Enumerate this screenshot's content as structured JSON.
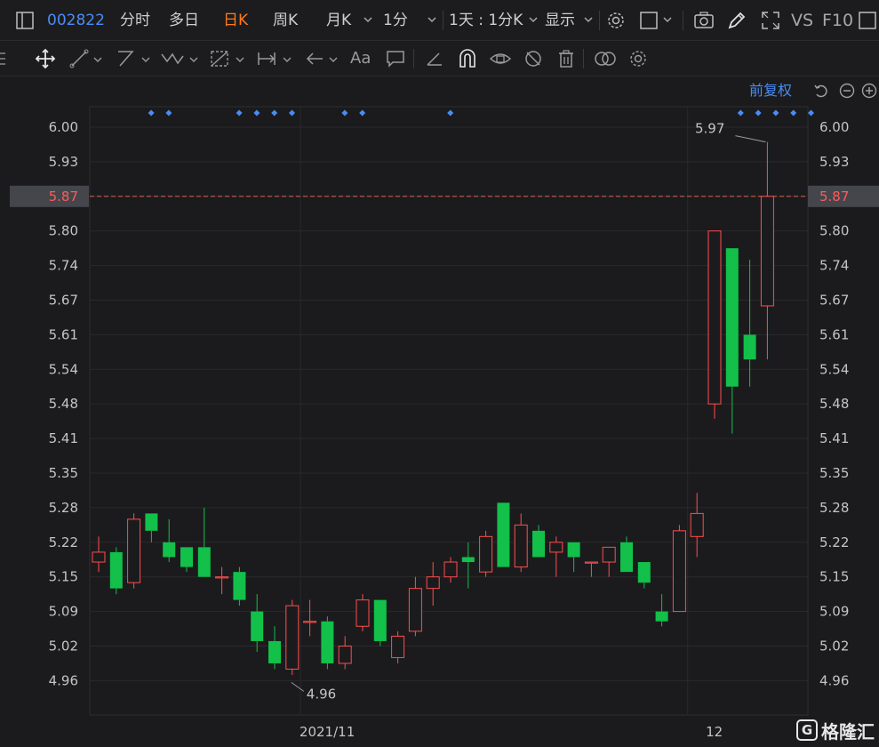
{
  "header": {
    "stock_code": "002822",
    "tabs": [
      {
        "label": "分时",
        "active": false
      },
      {
        "label": "多日",
        "active": false
      },
      {
        "label": "日K",
        "active": true
      },
      {
        "label": "周K",
        "active": false
      },
      {
        "label": "月K",
        "active": false
      }
    ],
    "interval_label": "1分",
    "multi_period_label": "1天 : 1分K",
    "display_label": "显示",
    "vs_label": "VS",
    "f10_label": "F10"
  },
  "drawing_tools": {
    "text_tool_label": "Aa"
  },
  "chart_header": {
    "adjust_label": "前复权"
  },
  "watermark": {
    "logo_glyph": "G",
    "text": "格隆汇"
  },
  "colors": {
    "up": "#ff4d4d",
    "down": "#12c04a",
    "accent": "#4a8cf5",
    "active_tab": "#ff7a1a",
    "grid": "#2a2a2d",
    "current_price_line": "#d6604a"
  },
  "chart_data": {
    "type": "candlestick",
    "y_axis": {
      "ticks": [
        "6.00",
        "5.93",
        "5.87",
        "5.80",
        "5.74",
        "5.67",
        "5.61",
        "5.54",
        "5.48",
        "5.41",
        "5.35",
        "5.28",
        "5.22",
        "5.15",
        "5.09",
        "5.02",
        "4.96"
      ],
      "range": [
        4.96,
        6.0
      ]
    },
    "x_axis": {
      "labels": [
        {
          "text": "2021/11",
          "index": 12
        },
        {
          "text": "12",
          "index": 34
        }
      ]
    },
    "current_price": "5.87",
    "annotations": [
      {
        "text": "5.97",
        "index": 38,
        "value": 5.97,
        "kind": "high"
      },
      {
        "text": "4.96",
        "index": 11,
        "value": 4.96,
        "kind": "low"
      }
    ],
    "event_marker_indices": [
      2,
      3,
      7,
      8,
      9,
      10,
      13,
      14,
      19,
      36,
      37,
      38,
      39,
      40
    ],
    "candles": [
      {
        "o": 5.18,
        "c": 5.2,
        "h": 5.23,
        "l": 5.16
      },
      {
        "o": 5.2,
        "c": 5.13,
        "h": 5.21,
        "l": 5.12
      },
      {
        "o": 5.14,
        "c": 5.26,
        "h": 5.27,
        "l": 5.13
      },
      {
        "o": 5.27,
        "c": 5.24,
        "h": 5.27,
        "l": 5.22
      },
      {
        "o": 5.22,
        "c": 5.19,
        "h": 5.26,
        "l": 5.18
      },
      {
        "o": 5.21,
        "c": 5.17,
        "h": 5.21,
        "l": 5.16
      },
      {
        "o": 5.21,
        "c": 5.15,
        "h": 5.28,
        "l": 5.15
      },
      {
        "o": 5.15,
        "c": 5.15,
        "h": 5.17,
        "l": 5.12
      },
      {
        "o": 5.16,
        "c": 5.11,
        "h": 5.17,
        "l": 5.1
      },
      {
        "o": 5.09,
        "c": 5.03,
        "h": 5.12,
        "l": 5.01
      },
      {
        "o": 5.03,
        "c": 4.99,
        "h": 5.06,
        "l": 4.98
      },
      {
        "o": 4.98,
        "c": 5.1,
        "h": 5.11,
        "l": 4.97
      },
      {
        "o": 5.07,
        "c": 5.07,
        "h": 5.11,
        "l": 5.04
      },
      {
        "o": 5.07,
        "c": 4.99,
        "h": 5.08,
        "l": 4.98
      },
      {
        "o": 4.99,
        "c": 5.02,
        "h": 5.04,
        "l": 4.98
      },
      {
        "o": 5.06,
        "c": 5.11,
        "h": 5.12,
        "l": 5.05
      },
      {
        "o": 5.11,
        "c": 5.03,
        "h": 5.11,
        "l": 5.02
      },
      {
        "o": 5.0,
        "c": 5.04,
        "h": 5.05,
        "l": 4.99
      },
      {
        "o": 5.05,
        "c": 5.13,
        "h": 5.15,
        "l": 5.04
      },
      {
        "o": 5.13,
        "c": 5.15,
        "h": 5.18,
        "l": 5.1
      },
      {
        "o": 5.15,
        "c": 5.18,
        "h": 5.19,
        "l": 5.14
      },
      {
        "o": 5.19,
        "c": 5.18,
        "h": 5.22,
        "l": 5.13
      },
      {
        "o": 5.16,
        "c": 5.23,
        "h": 5.24,
        "l": 5.15
      },
      {
        "o": 5.29,
        "c": 5.17,
        "h": 5.29,
        "l": 5.17
      },
      {
        "o": 5.17,
        "c": 5.25,
        "h": 5.27,
        "l": 5.16
      },
      {
        "o": 5.24,
        "c": 5.19,
        "h": 5.25,
        "l": 5.19
      },
      {
        "o": 5.2,
        "c": 5.22,
        "h": 5.23,
        "l": 5.15
      },
      {
        "o": 5.22,
        "c": 5.19,
        "h": 5.22,
        "l": 5.16
      },
      {
        "o": 5.18,
        "c": 5.18,
        "h": 5.18,
        "l": 5.15
      },
      {
        "o": 5.18,
        "c": 5.21,
        "h": 5.21,
        "l": 5.15
      },
      {
        "o": 5.22,
        "c": 5.16,
        "h": 5.23,
        "l": 5.16
      },
      {
        "o": 5.18,
        "c": 5.14,
        "h": 5.18,
        "l": 5.13
      },
      {
        "o": 5.09,
        "c": 5.07,
        "h": 5.12,
        "l": 5.06
      },
      {
        "o": 5.09,
        "c": 5.24,
        "h": 5.25,
        "l": 5.09
      },
      {
        "o": 5.23,
        "c": 5.27,
        "h": 5.31,
        "l": 5.19
      },
      {
        "o": 5.48,
        "c": 5.8,
        "h": 5.8,
        "l": 5.45
      },
      {
        "o": 5.77,
        "c": 5.51,
        "h": 5.77,
        "l": 5.42
      },
      {
        "o": 5.61,
        "c": 5.56,
        "h": 5.75,
        "l": 5.51
      },
      {
        "o": 5.66,
        "c": 5.87,
        "h": 5.97,
        "l": 5.56
      }
    ]
  }
}
